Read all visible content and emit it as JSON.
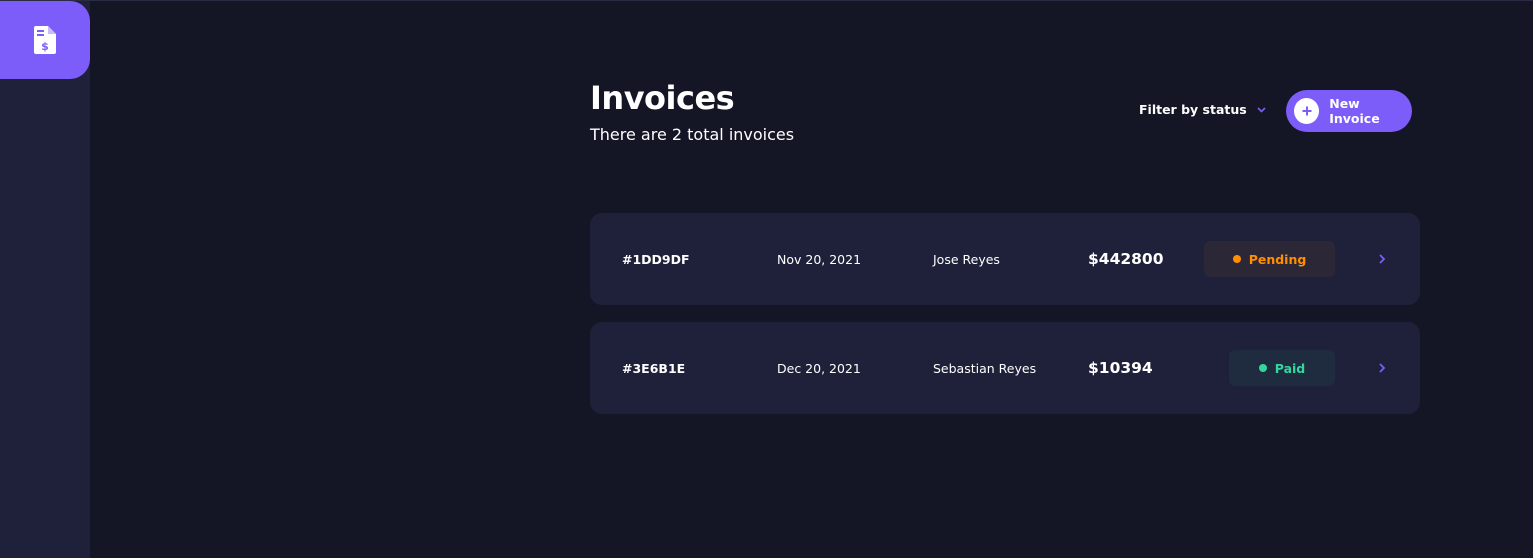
{
  "page": {
    "title": "Invoices",
    "subtitle": "There are 2 total invoices"
  },
  "toolbar": {
    "filter_label": "Filter by status",
    "new_invoice_label": "New Invoice"
  },
  "invoices": [
    {
      "id": "1DD9DF",
      "id_prefix": "#",
      "date": "Nov 20, 2021",
      "client": "Jose Reyes",
      "amount": "$442800",
      "status": "Pending",
      "status_color": "#ff8f00",
      "status_bg": "#2b2736"
    },
    {
      "id": "3E6B1E",
      "id_prefix": "#",
      "date": "Dec 20, 2021",
      "client": "Sebastian Reyes",
      "amount": "$10394",
      "status": "Paid",
      "status_color": "#33d69f",
      "status_bg": "#1f2c3f"
    }
  ],
  "colors": {
    "accent": "#7c5dfa",
    "background": "#141625",
    "card": "#1e2139"
  },
  "icons": {
    "logo": "invoice-dollar-icon",
    "filter": "chevron-down-icon",
    "new": "plus-icon",
    "row": "chevron-right-icon"
  }
}
